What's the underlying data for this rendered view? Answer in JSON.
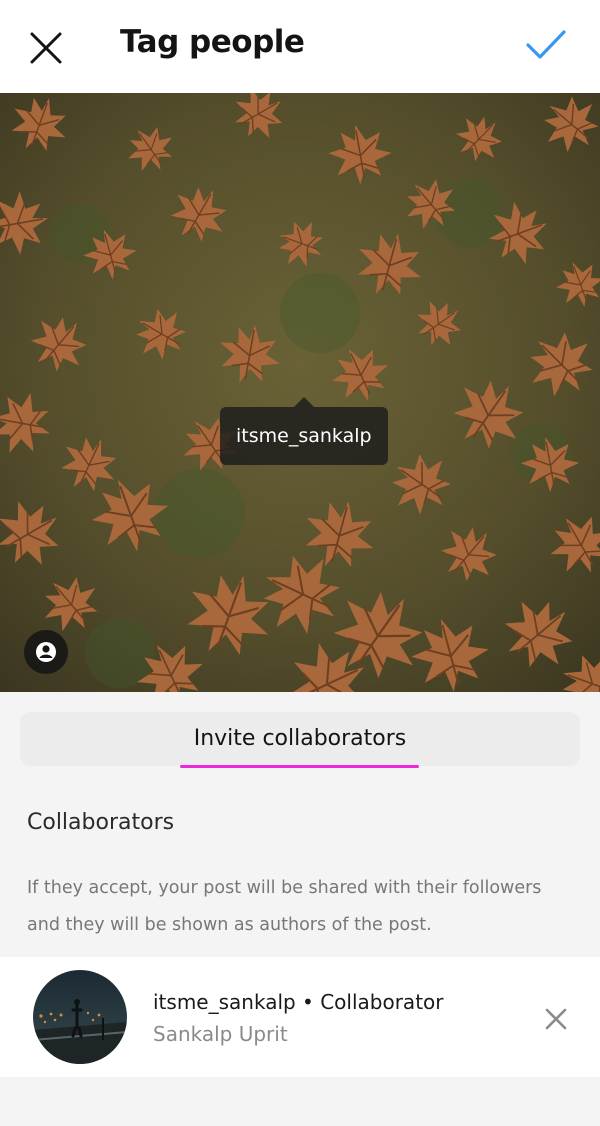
{
  "header": {
    "title": "Tag people",
    "close_icon": "close-icon",
    "done_icon": "checkmark-icon",
    "accent_color": "#3897f0"
  },
  "photo": {
    "tag_label": "itsme_sankalp",
    "tag_toggle_icon": "user-tag-icon"
  },
  "invite": {
    "label": "Invite collaborators",
    "underline_color": "#e92bd9"
  },
  "collaborators": {
    "heading": "Collaborators",
    "description": "If they accept, your post will be shared with their followers and they will be shown as authors of the post.",
    "items": [
      {
        "username_line": "itsme_sankalp • Collaborator",
        "full_name": "Sankalp Uprit",
        "remove_icon": "close-icon"
      }
    ]
  }
}
